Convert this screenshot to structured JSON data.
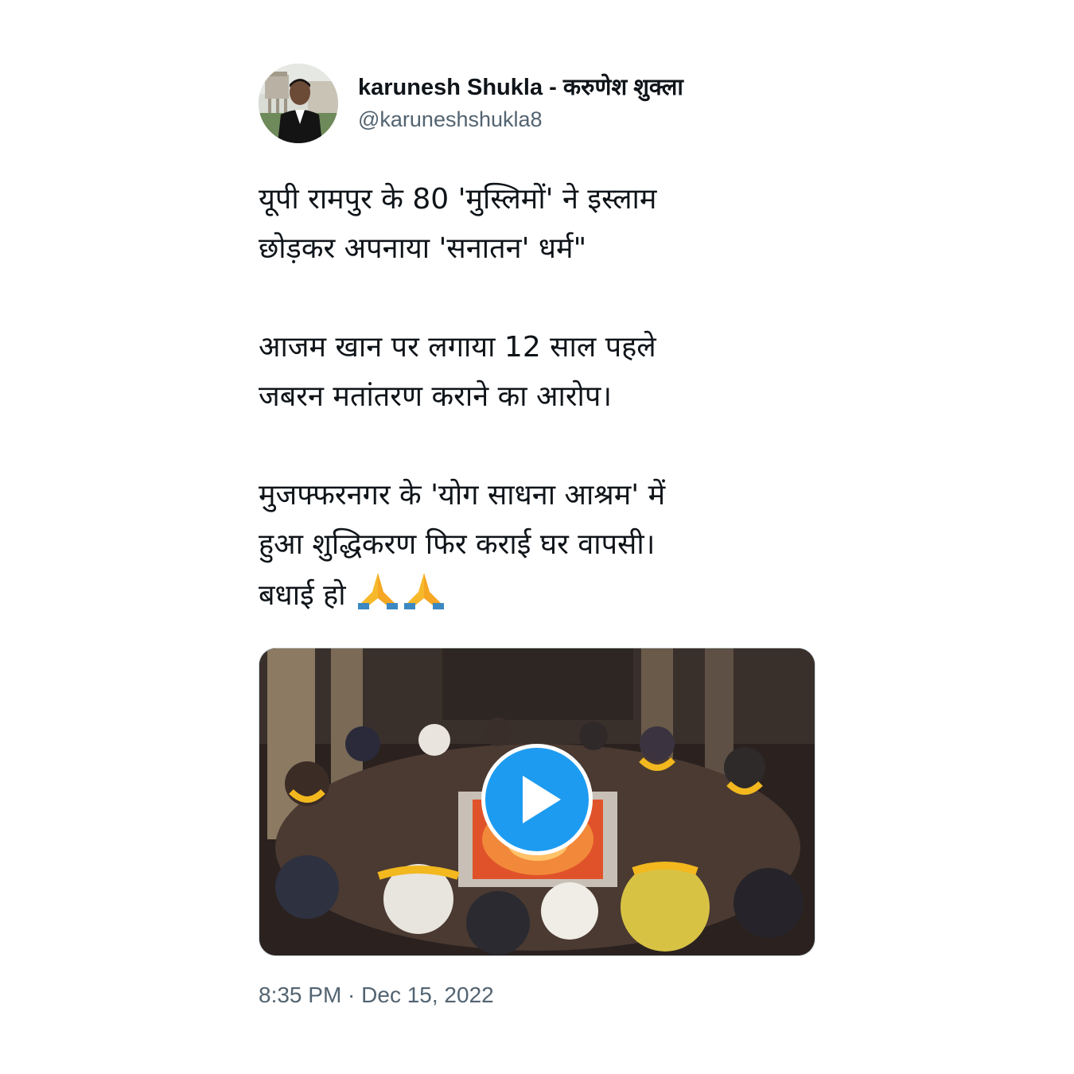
{
  "tweet": {
    "author": {
      "display_name": "karunesh Shukla - करुणेश शुक्ला",
      "handle": "@karuneshshukla8",
      "avatar_icon": "profile-photo"
    },
    "text": {
      "para1_line1": "यूपी रामपुर के 80 'मुस्लिमों' ने इस्लाम",
      "para1_line2": "छोड़कर अपनाया 'सनातन' धर्म\"",
      "para2_line1": "आजम खान पर लगाया 12 साल पहले",
      "para2_line2": "जबरन मतांतरण कराने का आरोप।",
      "para3_line1": "मुजफ्फरनगर के 'योग साधना आश्रम' में",
      "para3_line2": "हुआ शुद्धिकरण फिर कराई घर वापसी।",
      "para3_line3": "बधाई हो",
      "emoji": "folded-hands-emoji"
    },
    "media": {
      "type": "video",
      "play_icon": "play-icon",
      "accent_color": "#1d9bf0"
    },
    "timestamp": "8:35 PM · Dec 15, 2022"
  }
}
